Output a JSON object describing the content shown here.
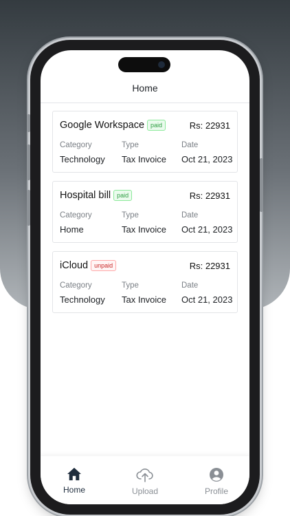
{
  "header": {
    "title": "Home"
  },
  "invoices": [
    {
      "name": "Google Workspace",
      "status": "paid",
      "amount": "Rs: 22931",
      "category_label": "Category",
      "category": "Technology",
      "type_label": "Type",
      "type": "Tax Invoice",
      "date_label": "Date",
      "date": "Oct 21, 2023"
    },
    {
      "name": "Hospital bill",
      "status": "paid",
      "amount": "Rs: 22931",
      "category_label": "Category",
      "category": "Home",
      "type_label": "Type",
      "type": "Tax Invoice",
      "date_label": "Date",
      "date": "Oct 21, 2023"
    },
    {
      "name": "iCloud",
      "status": "unpaid",
      "amount": "Rs: 22931",
      "category_label": "Category",
      "category": "Technology",
      "type_label": "Type",
      "type": "Tax Invoice",
      "date_label": "Date",
      "date": "Oct 21, 2023"
    }
  ],
  "tabbar": {
    "active": "home",
    "items": [
      {
        "label": "Home",
        "icon": "home-icon"
      },
      {
        "label": "Upload",
        "icon": "cloud-upload-icon"
      },
      {
        "label": "Profile",
        "icon": "user-circle-icon"
      }
    ]
  },
  "colors": {
    "paid": "#2f9e44",
    "unpaid": "#c92a2a",
    "active_tab": "#1f2d3d",
    "inactive_tab": "#8a8f95"
  }
}
